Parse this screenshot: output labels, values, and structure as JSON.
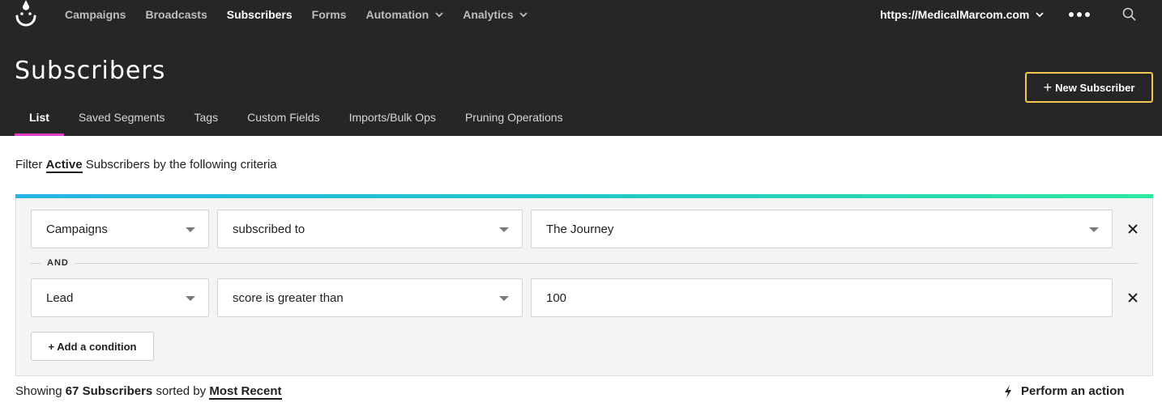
{
  "app": {
    "logo_icon": "smiley-drip-logo"
  },
  "nav": {
    "items": [
      {
        "label": "Campaigns",
        "active": false,
        "dropdown": false
      },
      {
        "label": "Broadcasts",
        "active": false,
        "dropdown": false
      },
      {
        "label": "Subscribers",
        "active": true,
        "dropdown": false
      },
      {
        "label": "Forms",
        "active": false,
        "dropdown": false
      },
      {
        "label": "Automation",
        "active": false,
        "dropdown": true
      },
      {
        "label": "Analytics",
        "active": false,
        "dropdown": true
      }
    ],
    "site": "https://MedicalMarcom.com",
    "more_icon": "ellipsis-icon",
    "search_icon": "search-icon"
  },
  "page": {
    "title": "Subscribers",
    "new_button": "New Subscriber"
  },
  "tabs": [
    {
      "label": "List",
      "active": true
    },
    {
      "label": "Saved Segments",
      "active": false
    },
    {
      "label": "Tags",
      "active": false
    },
    {
      "label": "Custom Fields",
      "active": false
    },
    {
      "label": "Imports/Bulk Ops",
      "active": false
    },
    {
      "label": "Pruning Operations",
      "active": false
    }
  ],
  "filter": {
    "prefix": "Filter",
    "status": "Active",
    "suffix": "Subscribers by the following criteria",
    "conditions": [
      {
        "field": "Campaigns",
        "operator": "subscribed to",
        "value": "The Journey",
        "value_is_select": true
      },
      {
        "field": "Lead",
        "operator": "score is greater than",
        "value": "100",
        "value_is_select": false
      }
    ],
    "joiner": "AND",
    "add_condition": "+ Add a condition"
  },
  "results": {
    "prefix": "Showing",
    "count": "67 Subscribers",
    "middle": "sorted by",
    "sort": "Most Recent",
    "action": "Perform an action"
  },
  "colors": {
    "header_bg": "#262626",
    "accent_tab": "#e040c8",
    "button_border": "#f2c94c",
    "gradient_start": "#24b4e6",
    "gradient_end": "#2ee6a0"
  }
}
